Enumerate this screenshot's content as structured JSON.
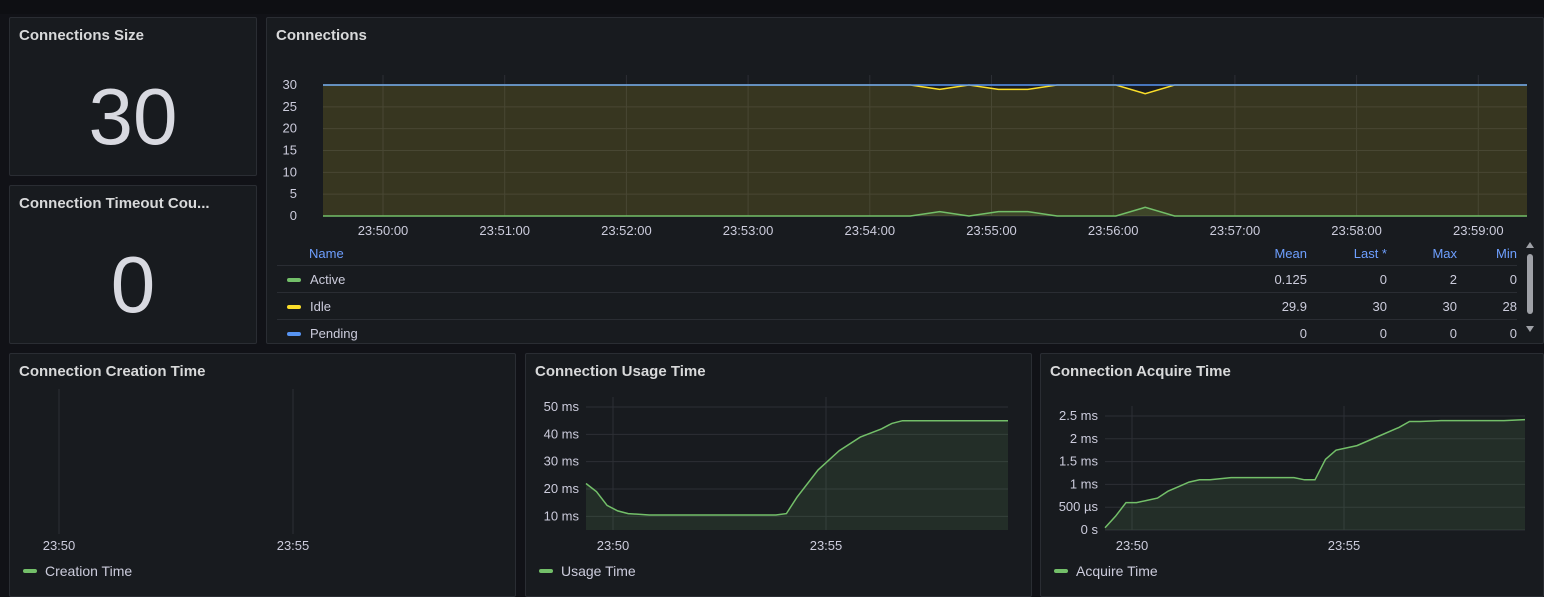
{
  "panels": {
    "size": {
      "title": "Connections Size",
      "value": "30"
    },
    "timeout": {
      "title": "Connection Timeout Cou...",
      "value": "0"
    },
    "connections": {
      "title": "Connections",
      "legend_headers": {
        "name": "Name",
        "mean": "Mean",
        "last": "Last *",
        "max": "Max",
        "min": "Min"
      },
      "legend_rows": [
        {
          "name": "Active",
          "color": "#73bf69",
          "mean": "0.125",
          "last": "0",
          "max": "2",
          "min": "0"
        },
        {
          "name": "Idle",
          "color": "#fade2a",
          "mean": "29.9",
          "last": "30",
          "max": "30",
          "min": "28"
        },
        {
          "name": "Pending",
          "color": "#5794f2",
          "mean": "0",
          "last": "0",
          "max": "0",
          "min": "0"
        }
      ]
    },
    "creation": {
      "title": "Connection Creation Time",
      "legend": "Creation Time"
    },
    "usage": {
      "title": "Connection Usage Time",
      "legend": "Usage Time"
    },
    "acquire": {
      "title": "Connection Acquire Time",
      "legend": "Acquire Time"
    }
  },
  "chart_data": [
    {
      "type": "area",
      "title": "Connections",
      "x_ticks": [
        "23:50:00",
        "23:51:00",
        "23:52:00",
        "23:53:00",
        "23:54:00",
        "23:55:00",
        "23:56:00",
        "23:57:00",
        "23:58:00",
        "23:59:00"
      ],
      "y_ticks": [
        "0",
        "5",
        "10",
        "15",
        "20",
        "25",
        "30"
      ],
      "ylim": [
        0,
        30
      ],
      "x_minutes": [
        -0.5,
        9.75
      ],
      "grid": true,
      "series": [
        {
          "name": "Idle",
          "color": "#fade2a",
          "x": [
            -0.5,
            4.5,
            4.75,
            5.0,
            5.25,
            5.5,
            5.75,
            6.0,
            6.25,
            6.5,
            6.75,
            9.75
          ],
          "values": [
            30,
            30,
            29,
            30,
            29,
            29,
            30,
            30,
            30,
            28,
            30,
            30
          ]
        },
        {
          "name": "Active",
          "color": "#73bf69",
          "x": [
            -0.5,
            4.5,
            4.75,
            5.0,
            5.25,
            5.5,
            5.75,
            6.0,
            6.25,
            6.5,
            6.75,
            9.75
          ],
          "values": [
            0,
            0,
            1,
            0,
            1,
            1,
            0,
            0,
            0,
            2,
            0,
            0
          ]
        },
        {
          "name": "Pending",
          "color": "#5794f2",
          "x": [
            -0.5,
            9.75
          ],
          "values": [
            30,
            30
          ]
        }
      ]
    },
    {
      "type": "line",
      "title": "Connection Creation Time",
      "x_ticks": [
        "23:50",
        "23:55"
      ],
      "series": [
        {
          "name": "Creation Time",
          "color": "#73bf69",
          "x": [],
          "values": []
        }
      ]
    },
    {
      "type": "area",
      "title": "Connection Usage Time",
      "x_ticks": [
        "23:50",
        "23:55"
      ],
      "y_ticks": [
        "10 ms",
        "20 ms",
        "30 ms",
        "40 ms",
        "50 ms"
      ],
      "ylim": [
        5,
        50
      ],
      "x_minutes": [
        -0.5,
        9.5
      ],
      "grid": true,
      "series": [
        {
          "name": "Usage Time",
          "color": "#73bf69",
          "x": [
            -0.5,
            -0.25,
            0,
            0.25,
            0.5,
            1,
            2,
            3,
            4,
            4.25,
            4.5,
            5,
            5.5,
            6,
            6.5,
            6.75,
            7,
            7.5,
            8,
            9.5
          ],
          "values": [
            22,
            19,
            14,
            12,
            11,
            10.5,
            10.5,
            10.5,
            10.5,
            11,
            17,
            27,
            34,
            39,
            42,
            44,
            45,
            45,
            45,
            45
          ]
        }
      ]
    },
    {
      "type": "area",
      "title": "Connection Acquire Time",
      "x_ticks": [
        "23:50",
        "23:55"
      ],
      "y_ticks": [
        "0 s",
        "500 µs",
        "1 ms",
        "1.5 ms",
        "2 ms",
        "2.5 ms"
      ],
      "ylim": [
        0,
        2.5
      ],
      "x_minutes": [
        -0.5,
        9.5
      ],
      "grid": true,
      "series": [
        {
          "name": "Acquire Time",
          "color": "#73bf69",
          "x": [
            -0.5,
            -0.25,
            0,
            0.25,
            0.5,
            0.75,
            1,
            1.25,
            1.5,
            1.75,
            2,
            2.5,
            3,
            3.5,
            4,
            4.25,
            4.5,
            4.75,
            5,
            5.5,
            6,
            6.5,
            6.75,
            7,
            7.5,
            8,
            9,
            9.5
          ],
          "values": [
            0.05,
            0.3,
            0.6,
            0.6,
            0.65,
            0.7,
            0.85,
            0.95,
            1.05,
            1.1,
            1.1,
            1.15,
            1.15,
            1.15,
            1.15,
            1.1,
            1.1,
            1.55,
            1.75,
            1.85,
            2.05,
            2.25,
            2.38,
            2.38,
            2.4,
            2.4,
            2.4,
            2.42
          ]
        }
      ]
    }
  ]
}
